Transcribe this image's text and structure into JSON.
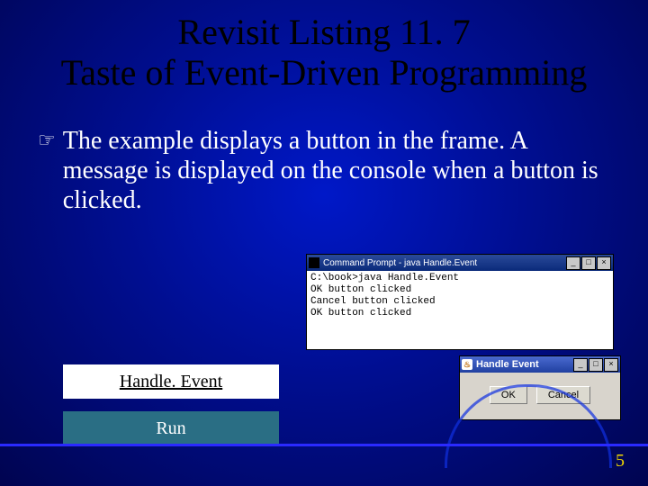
{
  "title_line1": "Revisit Listing 11. 7",
  "title_line2": "Taste of Event-Driven Programming",
  "bullet_text": "The example displays a button in the frame. A message is displayed on the console when a button is clicked.",
  "buttons": {
    "handle_event": "Handle. Event",
    "run": "Run"
  },
  "cmd_window": {
    "title": "Command Prompt - java Handle.Event",
    "lines": "C:\\book>java Handle.Event\nOK button clicked\nCancel button clicked\nOK button clicked",
    "min": "_",
    "max": "□",
    "close": "×"
  },
  "java_window": {
    "title": "Handle Event",
    "icon": "♨",
    "ok": "OK",
    "cancel": "Cancel",
    "min": "_",
    "max": "□",
    "close": "×"
  },
  "page_number": "5",
  "bullet_glyph": "☞"
}
